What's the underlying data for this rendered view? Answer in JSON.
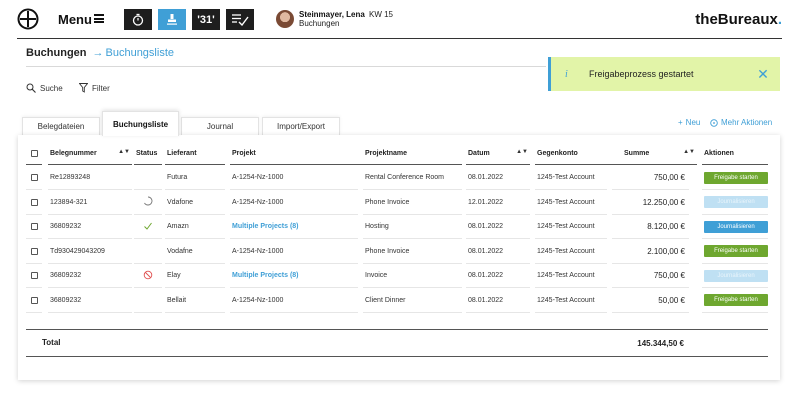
{
  "header": {
    "menu_label": "Menu",
    "toolbar_icons": [
      "stopwatch-icon",
      "stamp-icon",
      "calendar-icon",
      "checklist-icon"
    ],
    "calendar_text": "31",
    "user_name": "Steinmayer, Lena",
    "user_week": "KW 15",
    "user_sub": "Buchungen",
    "brand_main": "theBureaux",
    "brand_dot": "."
  },
  "breadcrumb": {
    "parent": "Buchungen",
    "current": "Buchungsliste"
  },
  "toast": {
    "message": "Freigabeprozess gestartet",
    "icon": "info-icon"
  },
  "controls": {
    "search": "Suche",
    "filter": "Filter"
  },
  "tabs": [
    "Belegdateien",
    "Buchungsliste",
    "Journal",
    "Import/Export"
  ],
  "active_tab": "Buchungsliste",
  "top_actions": {
    "new": "Neu",
    "more": "Mehr Aktionen"
  },
  "table": {
    "headers": {
      "belegnummer": "Belegnummer",
      "status": "Status",
      "lieferant": "Lieferant",
      "projekt": "Projekt",
      "projektname": "Projektname",
      "datum": "Datum",
      "gegenkonto": "Gegenkonto",
      "summe": "Summe",
      "aktionen": "Aktionen"
    },
    "rows": [
      {
        "beleg": "Re12893248",
        "status": "",
        "lieferant": "Futura",
        "projekt": "A-1254-Nz-1000",
        "projektname": "Rental Conference Room",
        "datum": "08.01.2022",
        "gegenkonto": "1245-Test Account",
        "summe": "750,00 €",
        "aktion": "Freigabe starten"
      },
      {
        "beleg": "123894-321",
        "status": "pending",
        "lieferant": "Vdafone",
        "projekt": "A-1254-Nz-1000",
        "projektname": "Phone Invoice",
        "datum": "12.01.2022",
        "gegenkonto": "1245-Test Account",
        "summe": "12.250,00 €",
        "aktion": "Journalisieren"
      },
      {
        "beleg": "36809232",
        "status": "approved",
        "lieferant": "Amazn",
        "projekt": "Multiple Projects   (8)",
        "projektname": "Hosting",
        "datum": "08.01.2022",
        "gegenkonto": "1245-Test Account",
        "summe": "8.120,00 €",
        "aktion": "Journalisieren"
      },
      {
        "beleg": "Td930429043209",
        "status": "",
        "lieferant": "Vodafne",
        "projekt": "A-1254-Nz-1000",
        "projektname": "Phone Invoice",
        "datum": "08.01.2022",
        "gegenkonto": "1245-Test Account",
        "summe": "2.100,00 €",
        "aktion": "Freigabe starten"
      },
      {
        "beleg": "36809232",
        "status": "rejected",
        "lieferant": "Elay",
        "projekt": "Multiple Projects   (8)",
        "projektname": "Invoice",
        "datum": "08.01.2022",
        "gegenkonto": "1245-Test Account",
        "summe": "750,00 €",
        "aktion": "Journalisieren"
      },
      {
        "beleg": "36809232",
        "status": "",
        "lieferant": "Bellait",
        "projekt": "A-1254-Nz-1000",
        "projektname": "Client Dinner",
        "datum": "08.01.2022",
        "gegenkonto": "1245-Test Account",
        "summe": "50,00 €",
        "aktion": "Freigabe starten"
      }
    ],
    "total_label": "Total",
    "total_value": "145.344,50 €"
  },
  "colors": {
    "accent": "#3f9fd6",
    "green": "#6ea72f",
    "toast_bg": "#e2f4a8"
  }
}
